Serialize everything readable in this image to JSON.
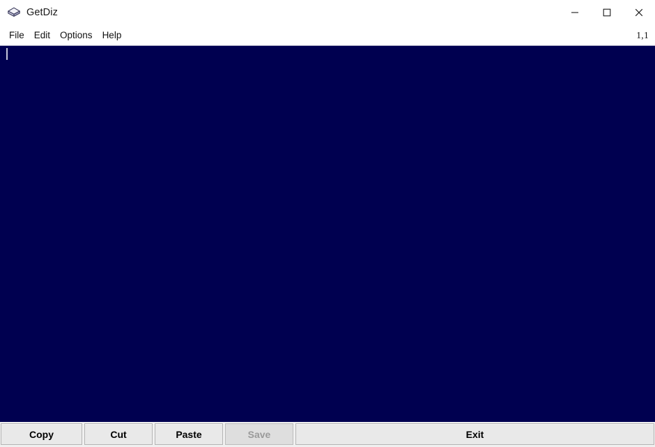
{
  "window": {
    "title": "GetDiz",
    "icon": "diamond-app-icon",
    "background_color": "#ffffff"
  },
  "window_controls": [
    {
      "name": "minimize",
      "glyph": "minimize-icon",
      "label": "Minimize"
    },
    {
      "name": "maximize",
      "glyph": "maximize-icon",
      "label": "Maximize"
    },
    {
      "name": "close",
      "glyph": "close-icon",
      "label": "Close"
    }
  ],
  "menu_bar": {
    "items": [
      {
        "label": "File"
      },
      {
        "label": "Edit"
      },
      {
        "label": "Options"
      },
      {
        "label": "Help"
      }
    ],
    "caret_position": "1,1"
  },
  "editor": {
    "content": "",
    "placeholder": "",
    "background_color": "#000050",
    "text_color": "#e8e8f5",
    "caret_visible": true,
    "caret_line": 1,
    "caret_column": 1
  },
  "button_bar": {
    "buttons": [
      {
        "label": "Copy",
        "enabled": true
      },
      {
        "label": "Cut",
        "enabled": true
      },
      {
        "label": "Paste",
        "enabled": true
      },
      {
        "label": "Save",
        "enabled": false
      },
      {
        "label": "Exit",
        "enabled": true
      }
    ]
  }
}
